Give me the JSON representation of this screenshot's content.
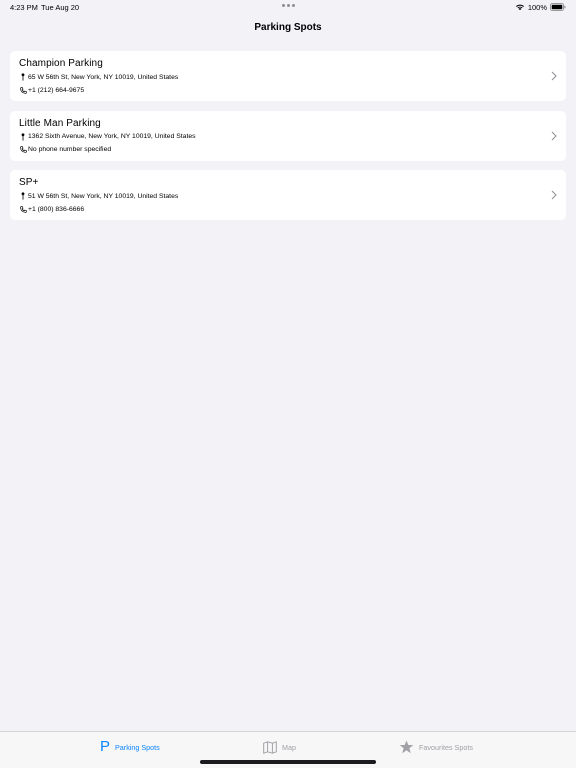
{
  "status_bar": {
    "time": "4:23 PM",
    "date": "Tue Aug 20",
    "battery": "100%",
    "icons": [
      "wifi-icon",
      "battery-icon"
    ]
  },
  "nav": {
    "title": "Parking Spots"
  },
  "spots": [
    {
      "name": "Champion Parking",
      "address": "65 W 56th St, New York, NY  10019, United States",
      "phone": "+1 (212) 664-9675"
    },
    {
      "name": "Little Man Parking",
      "address": "1362 Sixth Avenue, New York, NY  10019, United States",
      "phone": "No phone number specified"
    },
    {
      "name": "SP+",
      "address": "51 W 56th St, New York, NY  10019, United States",
      "phone": "+1 (800) 836-6666"
    }
  ],
  "tab_bar": {
    "tabs": [
      {
        "label": "Parking Spots",
        "icon": "p-letter-icon",
        "active": true
      },
      {
        "label": "Map",
        "icon": "map-icon",
        "active": false
      },
      {
        "label": "Favourites Spots",
        "icon": "star-icon",
        "active": false
      }
    ]
  },
  "colors": {
    "accent": "#0a84ff",
    "background": "#f2f2f7",
    "card": "#ffffff",
    "inactive": "#a0a0a5"
  }
}
